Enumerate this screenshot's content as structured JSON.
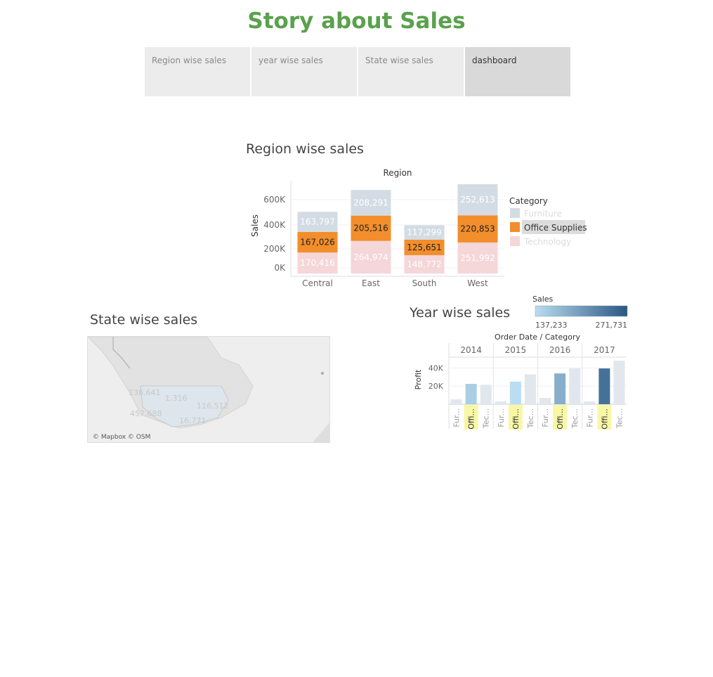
{
  "story": {
    "title": "Story about Sales"
  },
  "tabs": [
    {
      "label": "Region wise sales",
      "active": false
    },
    {
      "label": "year wise sales",
      "active": false
    },
    {
      "label": "State wise sales",
      "active": false
    },
    {
      "label": "dashboard",
      "active": true
    }
  ],
  "region_chart": {
    "title": "Region wise sales",
    "region_header": "Region",
    "y_label": "Sales",
    "legend_title": "Category",
    "legend": [
      {
        "name": "Furniture",
        "color": "#d3dce4"
      },
      {
        "name": "Office Supplies",
        "color": "#f28e2b"
      },
      {
        "name": "Technology",
        "color": "#f5d6d9"
      }
    ]
  },
  "state_map": {
    "title": "State wise sales",
    "attribution": "© Mapbox © OSM",
    "labels": [
      "136,641",
      "1,316",
      "116,512",
      "457,688",
      "16,771"
    ]
  },
  "year_chart": {
    "title": "Year wise sales",
    "color_legend_title": "Sales",
    "color_min": "137,233",
    "color_max": "271,731",
    "header": "Order Date  /  Category",
    "y_label": "Profit",
    "category_abbrev": [
      "Fur...",
      "Offi...",
      "Tec..."
    ]
  },
  "chart_data": [
    {
      "type": "bar",
      "stacked": true,
      "title": "Region wise sales",
      "xlabel": "Region",
      "ylabel": "Sales",
      "categories": [
        "Central",
        "East",
        "South",
        "West"
      ],
      "series": [
        {
          "name": "Technology",
          "values": [
            170416,
            264974,
            148772,
            251992
          ],
          "color": "#f5d6d9"
        },
        {
          "name": "Office Supplies",
          "values": [
            167026,
            205516,
            125651,
            220853
          ],
          "color": "#f28e2b"
        },
        {
          "name": "Furniture",
          "values": [
            163797,
            208291,
            117299,
            252613
          ],
          "color": "#d3dce4"
        }
      ],
      "ylim": [
        0,
        740000
      ],
      "yticks": [
        "0K",
        "200K",
        "400K",
        "600K"
      ],
      "legend": "right"
    },
    {
      "type": "bar",
      "title": "Year wise sales",
      "xlabel": "Order Date / Category",
      "ylabel": "Profit",
      "years": [
        "2014",
        "2015",
        "2016",
        "2017"
      ],
      "categories": [
        "Furniture",
        "Office Supplies",
        "Technology"
      ],
      "series": [
        {
          "name": "Furniture",
          "values": [
            5500,
            3000,
            7000,
            3000
          ],
          "color_sales": [
            157193,
            170518,
            198901,
            215387
          ]
        },
        {
          "name": "Office Supplies",
          "values": [
            22500,
            25000,
            34000,
            39500
          ],
          "color_sales": [
            151776,
            137233,
            183939,
            246097
          ]
        },
        {
          "name": "Technology",
          "values": [
            21500,
            33000,
            39500,
            48000
          ],
          "color_sales": [
            175278,
            162780,
            226364,
            271731
          ]
        }
      ],
      "ylim": [
        0,
        52000
      ],
      "yticks": [
        "20K",
        "40K"
      ],
      "color_range": [
        137233,
        271731
      ]
    }
  ]
}
